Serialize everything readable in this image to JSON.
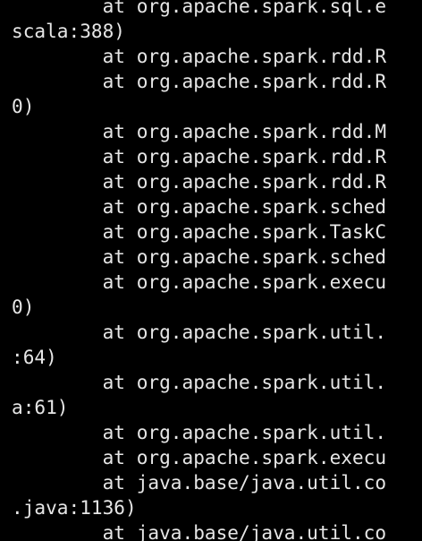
{
  "terminal": {
    "lines": [
      "        at org.apache.spark.sql.e",
      "scala:388)",
      "        at org.apache.spark.rdd.R",
      "        at org.apache.spark.rdd.R",
      "0)",
      "        at org.apache.spark.rdd.M",
      "        at org.apache.spark.rdd.R",
      "        at org.apache.spark.rdd.R",
      "        at org.apache.spark.sched",
      "        at org.apache.spark.TaskC",
      "        at org.apache.spark.sched",
      "        at org.apache.spark.execu",
      "0)",
      "        at org.apache.spark.util.",
      ":64)",
      "        at org.apache.spark.util.",
      "a:61)",
      "        at org.apache.spark.util.",
      "        at org.apache.spark.execu",
      "        at java.base/java.util.co",
      ".java:1136)",
      "        at java.base/java.util.co"
    ],
    "colors": {
      "background": "#000000",
      "text": "#e6e6e6"
    }
  }
}
